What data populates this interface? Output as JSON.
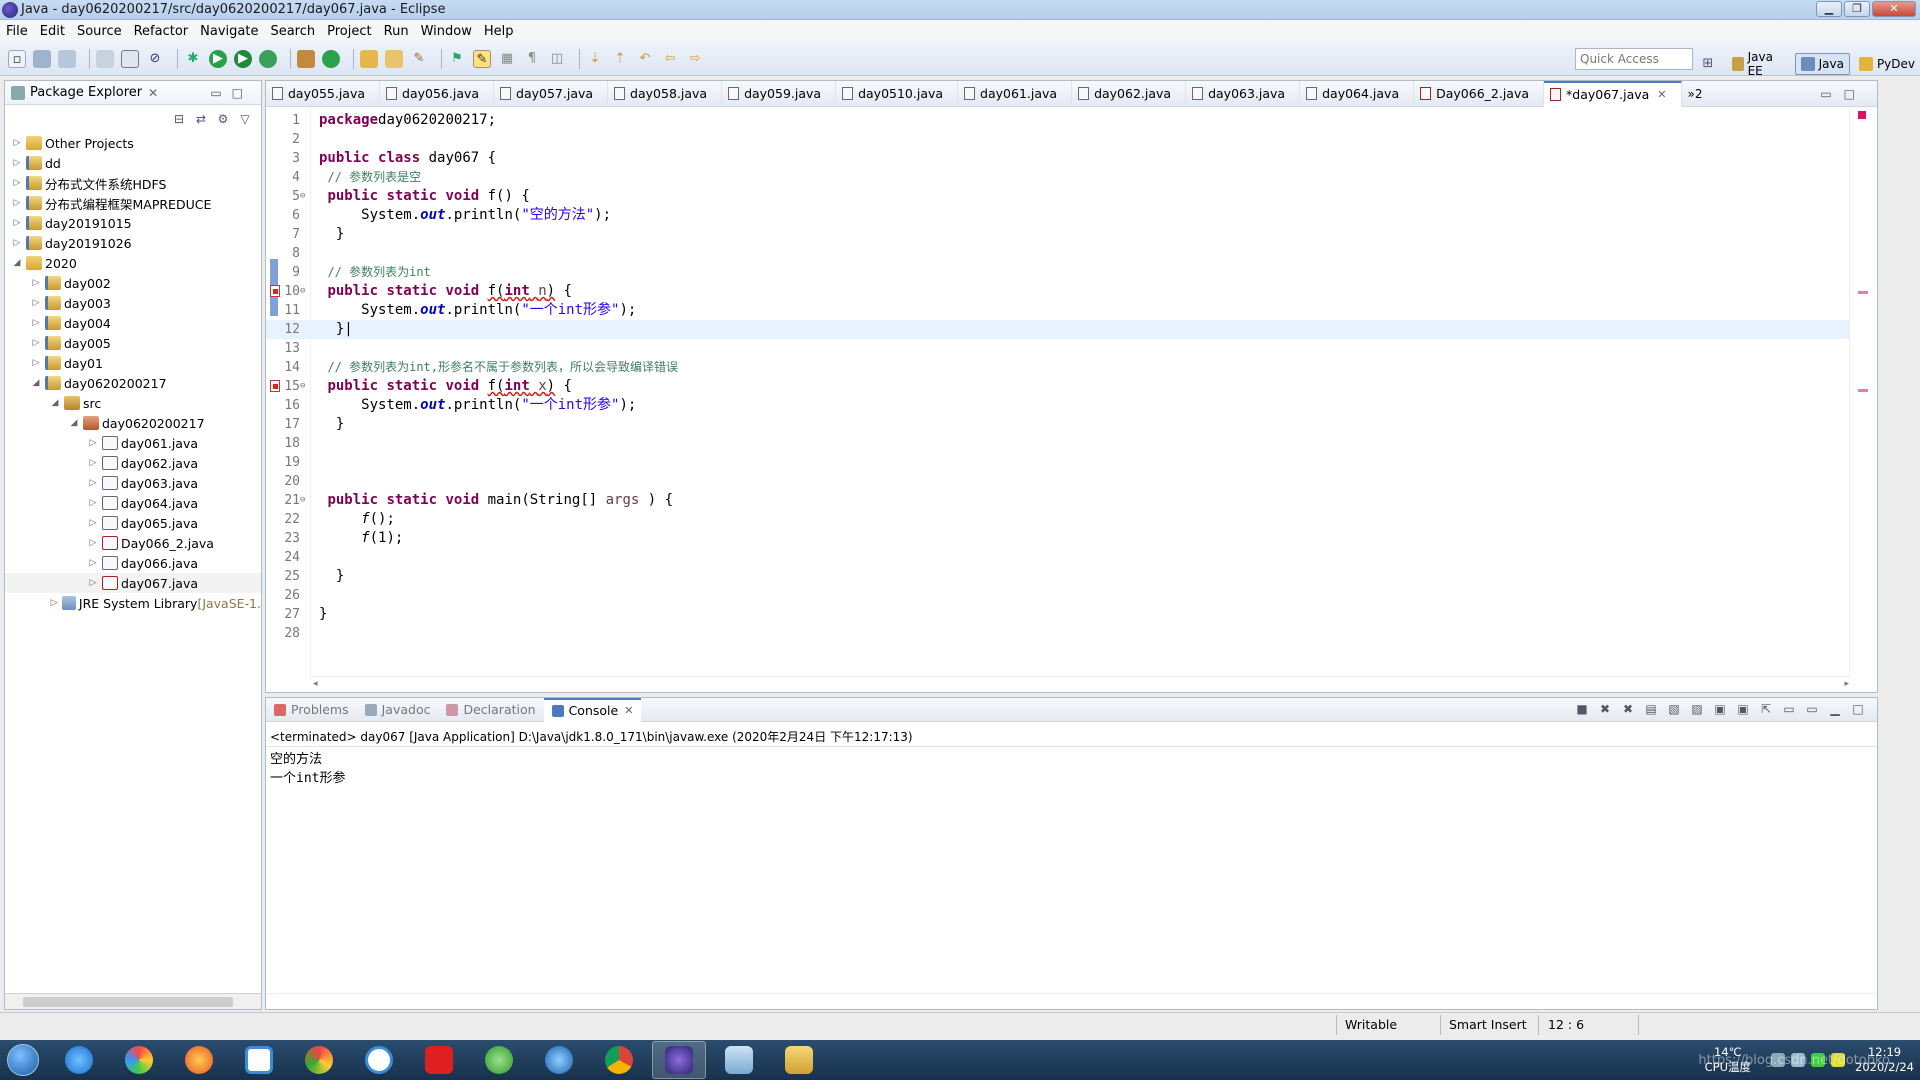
{
  "window": {
    "title": "Java - day0620200217/src/day0620200217/day067.java - Eclipse"
  },
  "menu": [
    "File",
    "Edit",
    "Source",
    "Refactor",
    "Navigate",
    "Search",
    "Project",
    "Run",
    "Window",
    "Help"
  ],
  "toolbar": {
    "quick_access_placeholder": "Quick Access",
    "perspectives": [
      {
        "label": "Java EE",
        "active": false
      },
      {
        "label": "Java",
        "active": true
      },
      {
        "label": "PyDev",
        "active": false
      }
    ]
  },
  "package_explorer": {
    "title": "Package Explorer",
    "tree": [
      {
        "label": "Other Projects",
        "depth": 0,
        "icon": "folder-icon",
        "toggle": "▷"
      },
      {
        "label": "dd",
        "depth": 0,
        "icon": "project-icon",
        "toggle": "▷"
      },
      {
        "label": "分布式文件系统HDFS",
        "depth": 0,
        "icon": "project-icon",
        "toggle": "▷"
      },
      {
        "label": "分布式编程框架MAPREDUCE",
        "depth": 0,
        "icon": "project-icon",
        "toggle": "▷"
      },
      {
        "label": "day20191015",
        "depth": 0,
        "icon": "project-icon",
        "toggle": "▷"
      },
      {
        "label": "day20191026",
        "depth": 0,
        "icon": "project-icon",
        "toggle": "▷"
      },
      {
        "label": "2020",
        "depth": 0,
        "icon": "folder-icon",
        "toggle": "◢"
      },
      {
        "label": "day002",
        "depth": 1,
        "icon": "project-icon",
        "toggle": "▷"
      },
      {
        "label": "day003",
        "depth": 1,
        "icon": "project-icon",
        "toggle": "▷"
      },
      {
        "label": "day004",
        "depth": 1,
        "icon": "project-icon",
        "toggle": "▷"
      },
      {
        "label": "day005",
        "depth": 1,
        "icon": "project-icon",
        "toggle": "▷"
      },
      {
        "label": "day01",
        "depth": 1,
        "icon": "project-icon",
        "toggle": "▷"
      },
      {
        "label": "day0620200217",
        "depth": 1,
        "icon": "project-icon",
        "toggle": "◢"
      },
      {
        "label": "src",
        "depth": 2,
        "icon": "source-folder-icon",
        "toggle": "◢"
      },
      {
        "label": "day0620200217",
        "depth": 3,
        "icon": "package-icon",
        "toggle": "◢"
      },
      {
        "label": "day061.java",
        "depth": 4,
        "icon": "java-file-icon",
        "toggle": "▷"
      },
      {
        "label": "day062.java",
        "depth": 4,
        "icon": "java-file-icon",
        "toggle": "▷"
      },
      {
        "label": "day063.java",
        "depth": 4,
        "icon": "java-file-icon",
        "toggle": "▷"
      },
      {
        "label": "day064.java",
        "depth": 4,
        "icon": "java-file-icon",
        "toggle": "▷"
      },
      {
        "label": "day065.java",
        "depth": 4,
        "icon": "java-file-icon",
        "toggle": "▷"
      },
      {
        "label": "Day066_2.java",
        "depth": 4,
        "icon": "java-file-error-icon",
        "toggle": "▷"
      },
      {
        "label": "day066.java",
        "depth": 4,
        "icon": "java-file-icon",
        "toggle": "▷"
      },
      {
        "label": "day067.java",
        "depth": 4,
        "icon": "java-file-error-icon",
        "toggle": "▷",
        "selected": true
      },
      {
        "label": "JRE System Library",
        "suffix": "[JavaSE-1.",
        "depth": 2,
        "icon": "library-icon",
        "toggle": "▷"
      }
    ]
  },
  "editor": {
    "tabs": [
      {
        "label": "day055.java",
        "active": false
      },
      {
        "label": "day056.java",
        "active": false
      },
      {
        "label": "day057.java",
        "active": false
      },
      {
        "label": "day058.java",
        "active": false
      },
      {
        "label": "day059.java",
        "active": false
      },
      {
        "label": "day0510.java",
        "active": false
      },
      {
        "label": "day061.java",
        "active": false
      },
      {
        "label": "day062.java",
        "active": false
      },
      {
        "label": "day063.java",
        "active": false
      },
      {
        "label": "day064.java",
        "active": false
      },
      {
        "label": "Day066_2.java",
        "active": false,
        "error": true
      },
      {
        "label": "*day067.java",
        "active": true,
        "error": true
      }
    ],
    "overflow_label": "»2",
    "current_line": 12,
    "lines": [
      {
        "n": "1",
        "tokens": [
          [
            "kw",
            "package"
          ],
          [
            "",
            "day0620200217;"
          ]
        ]
      },
      {
        "n": "2",
        "tokens": []
      },
      {
        "n": "3",
        "tokens": [
          [
            "kw",
            "public"
          ],
          [
            "",
            " "
          ],
          [
            "kw",
            "class"
          ],
          [
            "",
            " day067 {"
          ]
        ]
      },
      {
        "n": "4",
        "tokens": [
          [
            "",
            " "
          ],
          [
            "cm",
            "// 参数列表是空"
          ]
        ]
      },
      {
        "n": "5",
        "fold": true,
        "tokens": [
          [
            "",
            " "
          ],
          [
            "kw",
            "public"
          ],
          [
            "",
            " "
          ],
          [
            "kw",
            "static"
          ],
          [
            "",
            " "
          ],
          [
            "kw",
            "void"
          ],
          [
            "",
            " f() {"
          ]
        ]
      },
      {
        "n": "6",
        "tokens": [
          [
            "",
            "     System."
          ],
          [
            "fld",
            "out"
          ],
          [
            "",
            ".println("
          ],
          [
            "str",
            "\"空的方法\""
          ],
          [
            "",
            ");"
          ]
        ]
      },
      {
        "n": "7",
        "tokens": [
          [
            "",
            "  }"
          ]
        ]
      },
      {
        "n": "8",
        "tokens": []
      },
      {
        "n": "9",
        "tokens": [
          [
            "",
            " "
          ],
          [
            "cm",
            "// 参数列表为int"
          ]
        ]
      },
      {
        "n": "10",
        "fold": true,
        "error": true,
        "tokens": [
          [
            "",
            " "
          ],
          [
            "kw",
            "public"
          ],
          [
            "",
            " "
          ],
          [
            "kw",
            "static"
          ],
          [
            "",
            " "
          ],
          [
            "kw",
            "void"
          ],
          [
            "",
            " "
          ],
          [
            "err",
            "f("
          ],
          [
            "kwerr",
            "int"
          ],
          [
            "err",
            " "
          ],
          [
            "parerr",
            "n"
          ],
          [
            "err",
            ")"
          ],
          [
            "",
            " {"
          ]
        ]
      },
      {
        "n": "11",
        "tokens": [
          [
            "",
            "     System."
          ],
          [
            "fld",
            "out"
          ],
          [
            "",
            ".println("
          ],
          [
            "str",
            "\"一个int形参\""
          ],
          [
            "",
            ");"
          ]
        ]
      },
      {
        "n": "12",
        "tokens": [
          [
            "",
            "  }"
          ]
        ]
      },
      {
        "n": "13",
        "tokens": []
      },
      {
        "n": "14",
        "tokens": [
          [
            "",
            " "
          ],
          [
            "cm",
            "// 参数列表为int,形参名不属于参数列表，所以会导致编译错误"
          ]
        ]
      },
      {
        "n": "15",
        "fold": true,
        "error": true,
        "tokens": [
          [
            "",
            " "
          ],
          [
            "kw",
            "public"
          ],
          [
            "",
            " "
          ],
          [
            "kw",
            "static"
          ],
          [
            "",
            " "
          ],
          [
            "kw",
            "void"
          ],
          [
            "",
            " "
          ],
          [
            "err",
            "f("
          ],
          [
            "kwerr",
            "int"
          ],
          [
            "err",
            " "
          ],
          [
            "parerr",
            "x"
          ],
          [
            "err",
            ")"
          ],
          [
            "",
            " {"
          ]
        ]
      },
      {
        "n": "16",
        "tokens": [
          [
            "",
            "     System."
          ],
          [
            "fld",
            "out"
          ],
          [
            "",
            ".println("
          ],
          [
            "str",
            "\"一个int形参\""
          ],
          [
            "",
            ");"
          ]
        ]
      },
      {
        "n": "17",
        "tokens": [
          [
            "",
            "  }"
          ]
        ]
      },
      {
        "n": "18",
        "tokens": []
      },
      {
        "n": "19",
        "tokens": []
      },
      {
        "n": "20",
        "tokens": []
      },
      {
        "n": "21",
        "fold": true,
        "tokens": [
          [
            "",
            " "
          ],
          [
            "kw",
            "public"
          ],
          [
            "",
            " "
          ],
          [
            "kw",
            "static"
          ],
          [
            "",
            " "
          ],
          [
            "kw",
            "void"
          ],
          [
            "",
            " main(String[] "
          ],
          [
            "par",
            "args"
          ],
          [
            "",
            " ) {"
          ]
        ]
      },
      {
        "n": "22",
        "tokens": [
          [
            "",
            "     "
          ],
          [
            "it",
            "f"
          ],
          [
            "",
            "();"
          ]
        ]
      },
      {
        "n": "23",
        "tokens": [
          [
            "",
            "     "
          ],
          [
            "it",
            "f"
          ],
          [
            "",
            "(1);"
          ]
        ]
      },
      {
        "n": "24",
        "tokens": []
      },
      {
        "n": "25",
        "tokens": [
          [
            "",
            "  }"
          ]
        ]
      },
      {
        "n": "26",
        "tokens": []
      },
      {
        "n": "27",
        "tokens": [
          [
            "",
            "}"
          ]
        ]
      },
      {
        "n": "28",
        "tokens": []
      }
    ]
  },
  "console": {
    "tabs": [
      {
        "label": "Problems",
        "active": false,
        "icon": "problems-icon"
      },
      {
        "label": "Javadoc",
        "active": false,
        "icon": "javadoc-icon"
      },
      {
        "label": "Declaration",
        "active": false,
        "icon": "declaration-icon"
      },
      {
        "label": "Console",
        "active": true,
        "icon": "console-icon"
      }
    ],
    "terminated_line": "<terminated> day067 [Java Application] D:\\Java\\jdk1.8.0_171\\bin\\javaw.exe (2020年2月24日 下午12:17:13)",
    "output": [
      "空的方法",
      "一个int形参"
    ]
  },
  "statusbar": {
    "writable": "Writable",
    "insert_mode": "Smart Insert",
    "position": "12 : 6"
  },
  "taskbar": {
    "temperature": "14℃",
    "temperature_label": "CPU温度",
    "time": "12:19",
    "date": "2020/2/24",
    "watermark": "https://blog.csdn.net/dotobko"
  }
}
